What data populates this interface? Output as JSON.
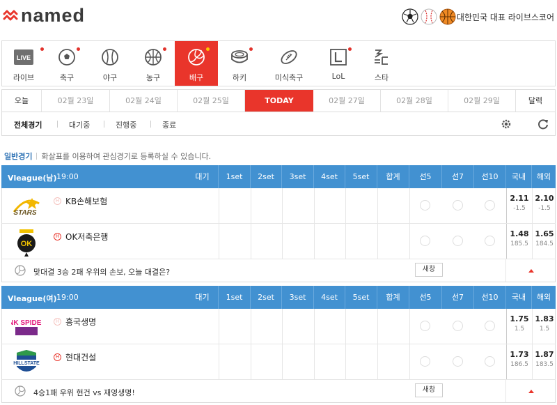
{
  "brand": {
    "logo_text": "named"
  },
  "header": {
    "tagline": "대한민국 대표 라이브스코어",
    "balls": [
      "soccer-ball-icon",
      "baseball-icon",
      "basketball-icon"
    ]
  },
  "sports": [
    {
      "id": "live",
      "label": "라이브",
      "icon": "live-icon",
      "dot": true,
      "active": false
    },
    {
      "id": "soccer",
      "label": "축구",
      "icon": "soccer-ball-icon",
      "dot": true,
      "active": false
    },
    {
      "id": "baseball",
      "label": "야구",
      "icon": "baseball-icon",
      "dot": false,
      "active": false
    },
    {
      "id": "basketball",
      "label": "농구",
      "icon": "basketball-icon",
      "dot": true,
      "active": false
    },
    {
      "id": "volleyball",
      "label": "배구",
      "icon": "volleyball-icon",
      "dot": true,
      "active": true
    },
    {
      "id": "hockey",
      "label": "하키",
      "icon": "hockey-puck-icon",
      "dot": true,
      "active": false
    },
    {
      "id": "football",
      "label": "미식축구",
      "icon": "american-football-icon",
      "dot": false,
      "active": false
    },
    {
      "id": "lol",
      "label": "LoL",
      "icon": "lol-icon",
      "dot": true,
      "active": false
    },
    {
      "id": "star",
      "label": "스타",
      "icon": "starcraft-icon",
      "dot": false,
      "active": false
    }
  ],
  "dates": [
    "오늘",
    "02월 23일",
    "02월 24일",
    "02월 25일",
    "TODAY",
    "02월 27일",
    "02월 28일",
    "02월 29일",
    "달력"
  ],
  "filters": [
    "전체경기",
    "대기중",
    "진행중",
    "종료"
  ],
  "info": {
    "category": "일반경기",
    "text": "화살표를 이용하여 관심경기로 등록하실 수 있습니다."
  },
  "columns": [
    "대기",
    "1set",
    "2set",
    "3set",
    "4set",
    "5set",
    "합계",
    "선5",
    "선7",
    "선10",
    "국내",
    "해외"
  ],
  "live_logo_text": "LIVE",
  "home_marker": "H",
  "games": [
    {
      "league": "Vleague(남)",
      "time": "19:00",
      "teams": [
        {
          "name": "KB손해보험",
          "logo": "kb-stars-logo",
          "logo_text": "STARS",
          "home": false,
          "domestic": {
            "odd": "2.11",
            "line": "-1.5"
          },
          "overseas": {
            "odd": "2.10",
            "line": "-1.5"
          }
        },
        {
          "name": "OK저축은행",
          "logo": "ok-savings-logo",
          "logo_text": "OK",
          "home": true,
          "domestic": {
            "odd": "1.48",
            "line": "185.5"
          },
          "overseas": {
            "odd": "1.65",
            "line": "184.5"
          }
        }
      ],
      "comment": "맞대결 3승 2패 우위의 손보, 오늘 대결은?",
      "new_window": "새창"
    },
    {
      "league": "Vleague(여)",
      "time": "19:00",
      "teams": [
        {
          "name": "흥국생명",
          "logo": "pink-spiders-logo",
          "logo_text": "PINK SPIDERS",
          "home": false,
          "domestic": {
            "odd": "1.75",
            "line": "1.5"
          },
          "overseas": {
            "odd": "1.83",
            "line": "1.5"
          }
        },
        {
          "name": "현대건설",
          "logo": "hillstate-logo",
          "logo_text": "HILLSTATE",
          "home": true,
          "domestic": {
            "odd": "1.73",
            "line": "186.5"
          },
          "overseas": {
            "odd": "1.87",
            "line": "183.5"
          }
        }
      ],
      "comment": "4승1패 우위 현건 vs 재영생명!",
      "new_window": "새창"
    }
  ],
  "colors": {
    "accent": "#e9352b",
    "header_blue": "#4291d1",
    "link_blue": "#2f73b5"
  }
}
